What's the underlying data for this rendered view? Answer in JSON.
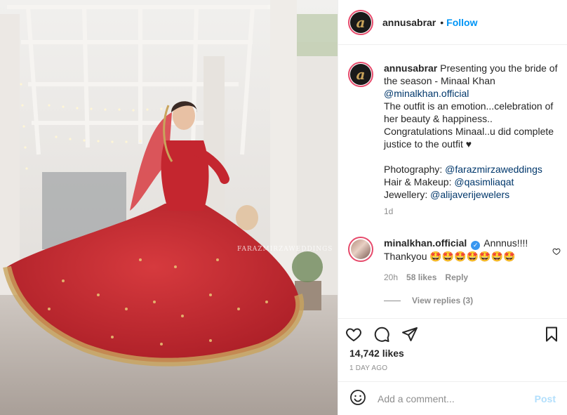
{
  "photo": {
    "watermark": "FARAZMIRZAWEDDINGS"
  },
  "header": {
    "avatar_letter": "a",
    "username": "annusabrar",
    "separator": "•",
    "follow_label": "Follow"
  },
  "caption": {
    "avatar_letter": "a",
    "username": "annusabrar",
    "text_1": " Presenting you the bride of the season - Minaal Khan",
    "mention_1": "@minalkhan.official",
    "text_2": "The outfit is an emotion...celebration of her beauty & happiness.. Congratulations Minaal..u did complete justice to the outfit ♥",
    "photo_label": "Photography: ",
    "photo_mention": "@farazmirzaweddings",
    "hair_label": "Hair & Makeup: ",
    "hair_mention": "@qasimliaqat",
    "jewel_label": "Jewellery: ",
    "jewel_mention": "@alijaverijewelers",
    "time": "1d"
  },
  "reply": {
    "username": "minalkhan.official",
    "verified_glyph": "✓",
    "text": "Annnus!!!! Thankyou 🤩🤩🤩🤩🤩🤩🤩",
    "time": "20h",
    "likes": "58 likes",
    "reply_label": "Reply"
  },
  "view_replies": "View replies (3)",
  "actions": {
    "likes": "14,742 likes",
    "date": "1 DAY AGO"
  },
  "comment_box": {
    "placeholder": "Add a comment...",
    "post_label": "Post"
  },
  "icons": {
    "like": "heart-icon",
    "comment": "comment-bubble-icon",
    "share": "paper-plane-icon",
    "save": "bookmark-icon",
    "emoji": "smiley-icon",
    "comment_like": "heart-small-icon"
  },
  "colors": {
    "accent_blue": "#0095f6",
    "story_ring": "#e64a6b",
    "verified": "#3897f0",
    "muted_text": "#8e8e8e",
    "mention": "#00376b",
    "post_disabled": "#b2dffc",
    "dress_red": "#c8262f"
  }
}
